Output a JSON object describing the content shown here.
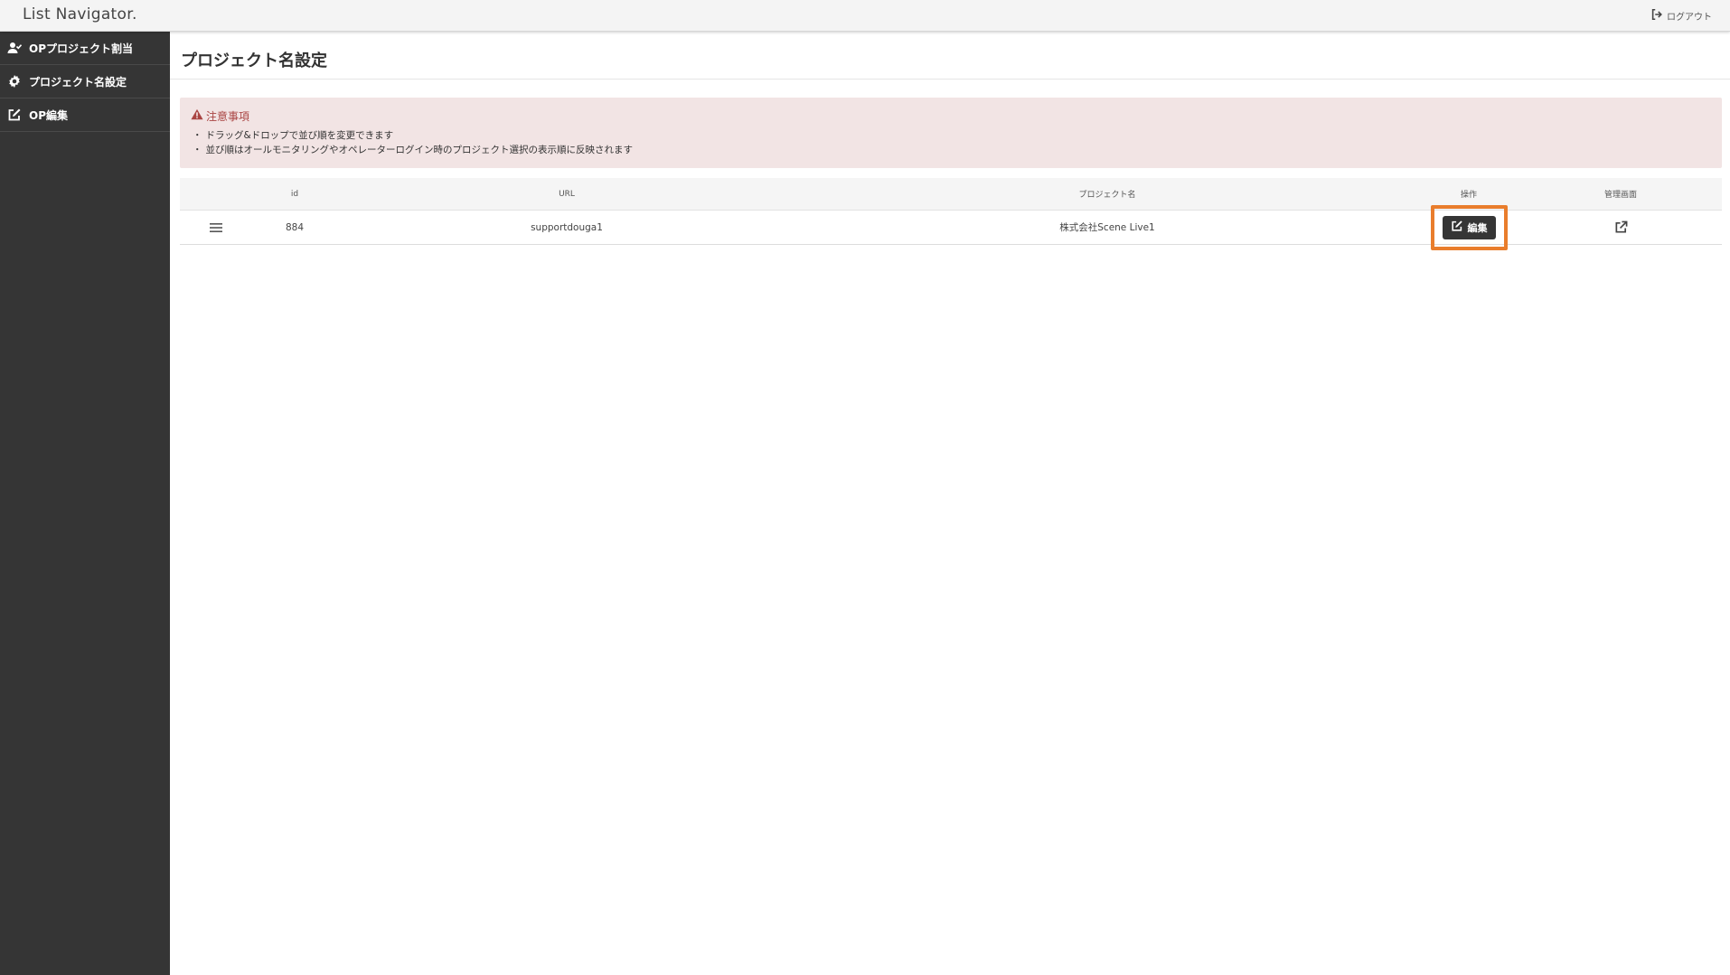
{
  "app": {
    "brand": "List Navigator.",
    "logout_label": "ログアウト"
  },
  "sidebar": {
    "items": [
      {
        "label": "OPプロジェクト割当",
        "icon": "user-check-icon"
      },
      {
        "label": "プロジェクト名設定",
        "icon": "gear-icon"
      },
      {
        "label": "OP編集",
        "icon": "edit-icon"
      }
    ]
  },
  "page": {
    "title": "プロジェクト名設定"
  },
  "notice": {
    "heading": "注意事項",
    "items": [
      "ドラッグ&ドロップで並び順を変更できます",
      "並び順はオールモニタリングやオペレーターログイン時のプロジェクト選択の表示順に反映されます"
    ]
  },
  "table": {
    "headers": {
      "handle": "",
      "id": "id",
      "url": "URL",
      "project_name": "プロジェクト名",
      "action": "操作",
      "admin": "管理画面"
    },
    "rows": [
      {
        "id": "884",
        "url": "supportdouga1",
        "project_name": "株式会社Scene Live1",
        "edit_label": "編集"
      }
    ]
  },
  "colors": {
    "sidebar_bg": "#353535",
    "notice_bg": "#f2e4e4",
    "notice_text": "#a94442",
    "highlight": "#e97d2c"
  }
}
